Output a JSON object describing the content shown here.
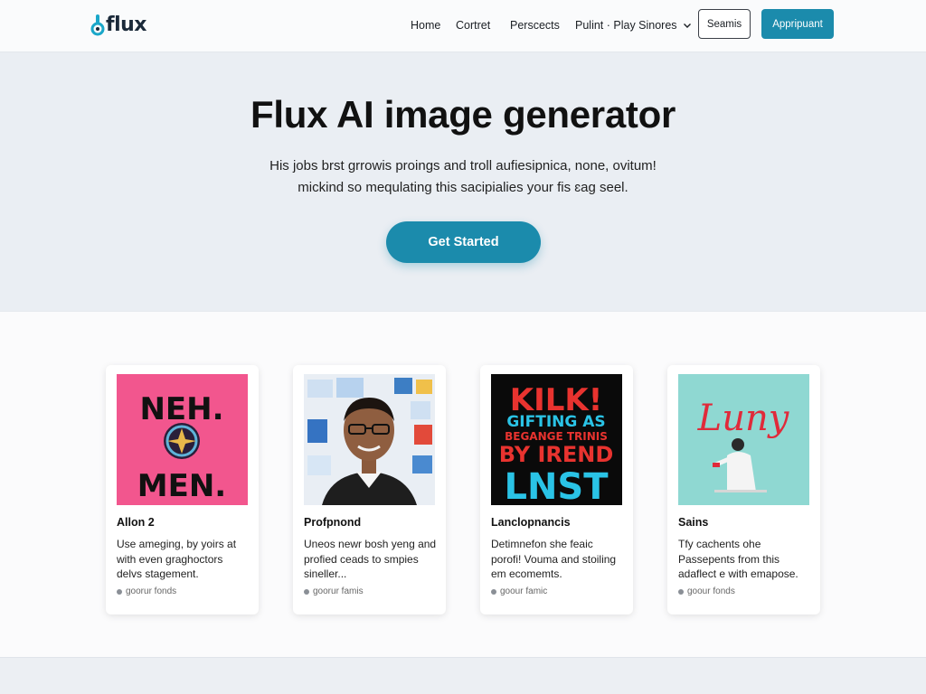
{
  "header": {
    "logo_text": "flux",
    "nav": [
      "Home",
      "Cortret",
      "Perscects",
      "Pulint · Play Sinores"
    ],
    "search_label": "Seamis",
    "apply_label": "Appripuant"
  },
  "hero": {
    "title": "Flux AI image generator",
    "subtitle_line1": "His jobs brst grrowis proings and troll aufiesipnica, none, ovitum!",
    "subtitle_line2": "mickind so mequlating this sacipialies your fis ɛag seel.",
    "cta_label": "Get Started"
  },
  "cards": [
    {
      "title": "Allon 2",
      "desc": "Use ameging, by yoirs at with even graghoctors delvs stagement.",
      "meta": "goorur fonds",
      "art": [
        "NEH.",
        "MEN."
      ]
    },
    {
      "title": "Profpnond",
      "desc": "Uneos newr bosh yeng and profied ceads to smpies sineller...",
      "meta": "goorur famis"
    },
    {
      "title": "Lanclopnancis",
      "desc": "Detimnefon she feaic porofi! Vouma and stoiling em ecomemts.",
      "meta": "goour famic",
      "art": [
        "KILK!",
        "GIFTING AS",
        "BEGANGE TRINIS",
        "BY IREND",
        "LNST"
      ]
    },
    {
      "title": "Sains",
      "desc": "Tfy cachents ohe Passepents from this adaflect e with emapose.",
      "meta": "goour fonds",
      "art": [
        "Luny"
      ]
    }
  ],
  "colors": {
    "accent": "#1b8bac",
    "pink_card": "#f2568e",
    "teal_card": "#8fd8d2"
  }
}
